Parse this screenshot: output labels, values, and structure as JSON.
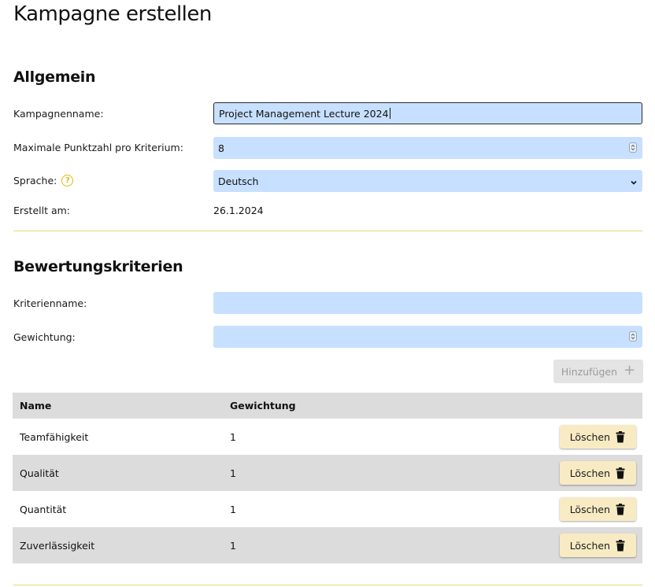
{
  "page_title": "Kampagne erstellen",
  "general": {
    "heading": "Allgemein",
    "campaign_name": {
      "label": "Kampagnenname:",
      "value": "Project Management Lecture 2024"
    },
    "max_points": {
      "label": "Maximale Punktzahl pro Kriterium:",
      "value": "8"
    },
    "language": {
      "label": "Sprache:",
      "value": "Deutsch",
      "help_icon": "question-circle-icon"
    },
    "created": {
      "label": "Erstellt am:",
      "value": "26.1.2024"
    }
  },
  "criteria": {
    "heading": "Bewertungskriterien",
    "name_field": {
      "label": "Kriterienname:",
      "value": ""
    },
    "weight_field": {
      "label": "Gewichtung:",
      "value": ""
    },
    "add_button": {
      "label": "Hinzufügen",
      "icon": "plus-icon"
    },
    "table": {
      "headers": {
        "name": "Name",
        "weight": "Gewichtung"
      },
      "rows": [
        {
          "name": "Teamfähigkeit",
          "weight": "1",
          "delete_label": "Löschen"
        },
        {
          "name": "Qualität",
          "weight": "1",
          "delete_label": "Löschen"
        },
        {
          "name": "Quantität",
          "weight": "1",
          "delete_label": "Löschen"
        },
        {
          "name": "Zuverlässigkeit",
          "weight": "1",
          "delete_label": "Löschen"
        }
      ]
    }
  },
  "colors": {
    "input_bg": "#c7e0ff",
    "accent_yellow": "#e3b418",
    "delete_button_bg": "#f8ebc4",
    "table_stripe": "#dcdcdc"
  }
}
